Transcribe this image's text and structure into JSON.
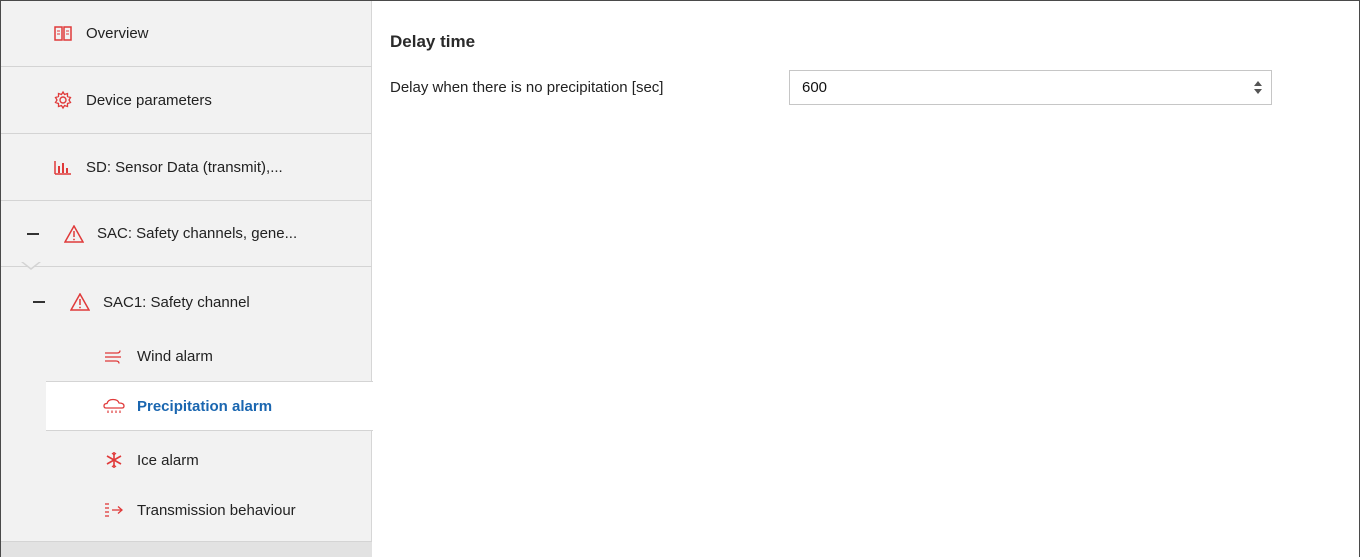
{
  "sidebar": {
    "items": [
      {
        "label": "Overview",
        "icon": "book-icon"
      },
      {
        "label": "Device parameters",
        "icon": "gear-icon"
      },
      {
        "label": "SD: Sensor Data (transmit),...",
        "icon": "bar-chart-icon"
      },
      {
        "label": "SAC: Safety channels, gene...",
        "icon": "warning-icon"
      },
      {
        "label": "SAC1:  Safety channel",
        "icon": "warning-icon"
      },
      {
        "label": "Wind alarm",
        "icon": "wind-icon"
      },
      {
        "label": "Precipitation alarm",
        "icon": "rain-cloud-icon"
      },
      {
        "label": "Ice alarm",
        "icon": "snowflake-icon"
      },
      {
        "label": "Transmission behaviour",
        "icon": "transmit-icon"
      }
    ],
    "selected_index": 6
  },
  "main": {
    "section_title": "Delay time",
    "field_label": "Delay when there is no precipitation [sec]",
    "field_value": "600"
  },
  "colors": {
    "accent": "#1a66b0",
    "icon_red": "#e03a3a",
    "sidebar_bg": "#f2f2f2"
  }
}
